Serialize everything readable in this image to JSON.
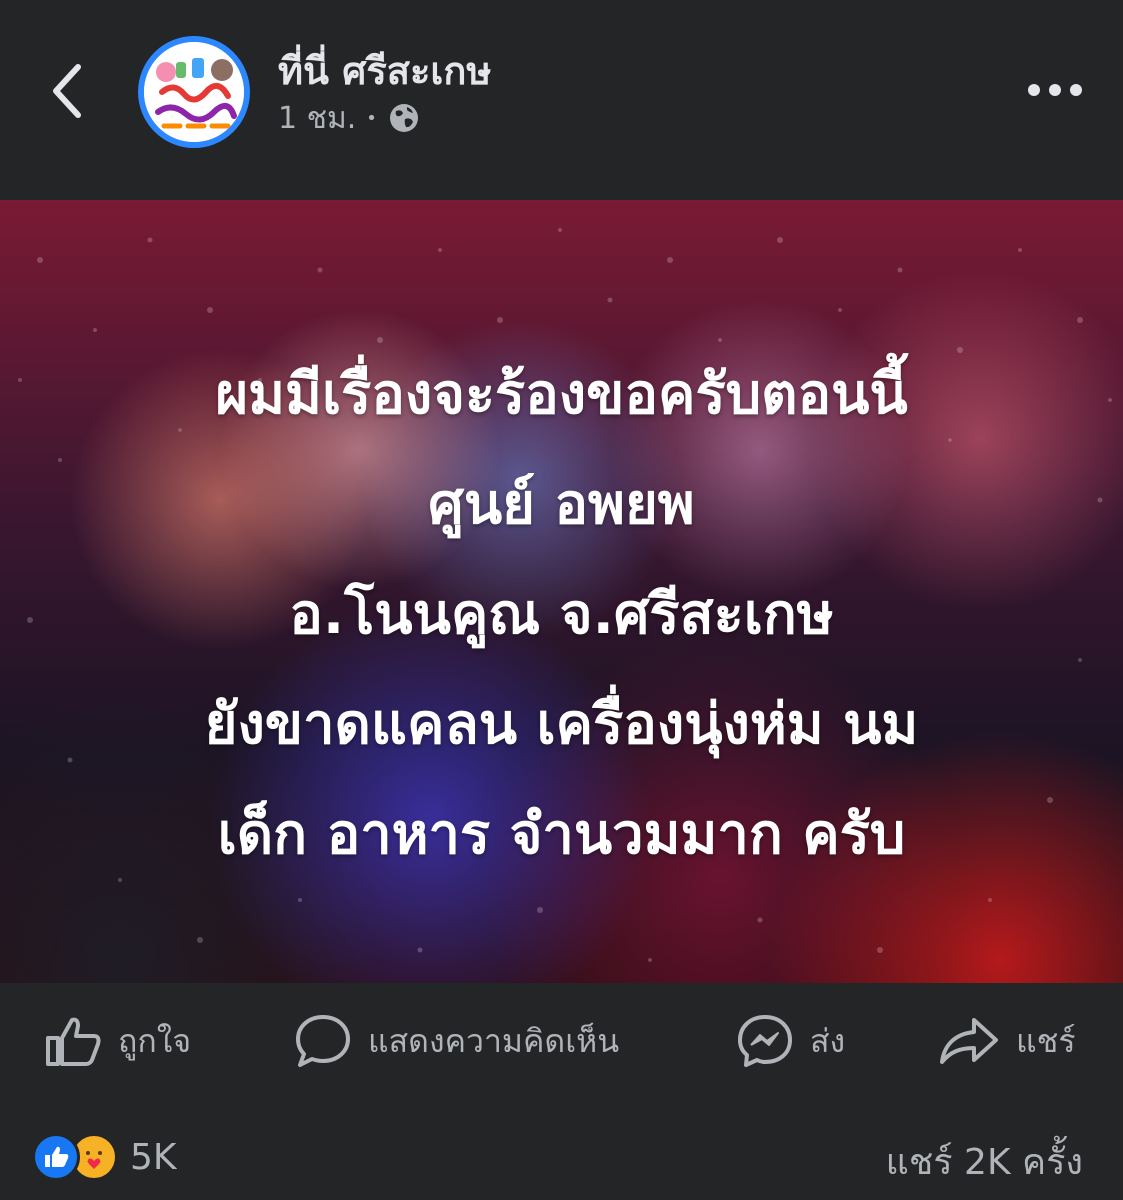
{
  "post": {
    "page_name": "ที่นี่ ศรีสะเกษ",
    "time": "1 ชม.",
    "separator": "•",
    "text_lines": [
      "ผมมีเรื่องจะร้องขอครับตอนนี้",
      "ศูนย์ อพยพ",
      "อ.โนนคูณ จ.ศรีสะเกษ",
      "ยังขาดแคลน เครื่องนุ่งห่ม นม",
      "เด็ก อาหาร จำนวมมาก ครับ"
    ]
  },
  "actions": {
    "like": "ถูกใจ",
    "comment": "แสดงความคิดเห็น",
    "send": "ส่ง",
    "share": "แชร์"
  },
  "footer": {
    "reaction_count": "5K",
    "share_count": "แชร์ 2K ครั้ง"
  },
  "icons": {
    "back": "chevron-left-icon",
    "more": "more-dots-icon",
    "privacy": "globe-icon",
    "like": "thumbs-up-icon",
    "comment": "comment-bubble-icon",
    "send": "messenger-icon",
    "share": "share-arrow-icon"
  },
  "colors": {
    "background": "#242526",
    "text_primary": "#e4e6eb",
    "text_secondary": "#b0b3b8",
    "avatar_ring": "#2d88ff",
    "like_reaction": "#1877f2",
    "care_reaction": "#f7b125"
  }
}
